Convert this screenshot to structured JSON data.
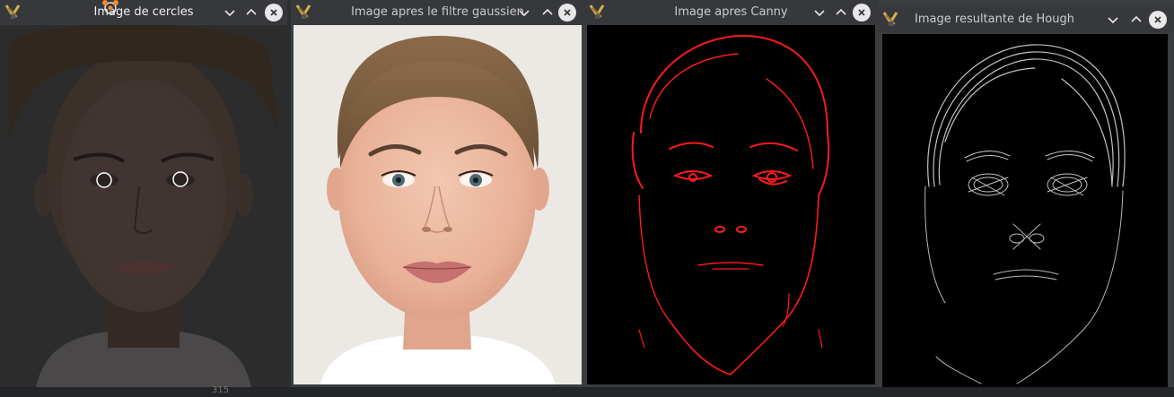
{
  "windows": [
    {
      "title": "Image de cercles"
    },
    {
      "title": "Image apres le filtre gaussien"
    },
    {
      "title": "Image apres Canny"
    },
    {
      "title": "Image resultante de Hough"
    }
  ],
  "status": {
    "value": "315"
  },
  "colors": {
    "titlebar": "#36383c",
    "canny_edges": "#ff0000",
    "hough_edges": "#d8d8d8",
    "background": "#000000"
  }
}
